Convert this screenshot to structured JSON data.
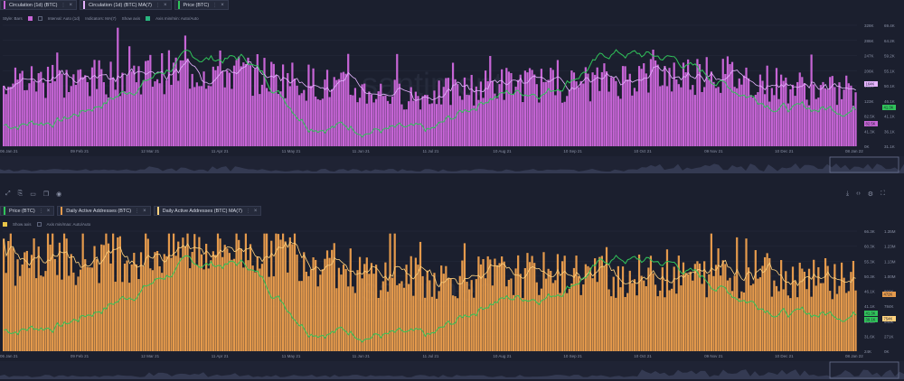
{
  "top": {
    "tabs": [
      {
        "label": "Circulation (1d) (BTC)",
        "color": "#c765d6"
      },
      {
        "label": "Circulation (1d) (BTC) MA(7)",
        "color": "#e6b4ff"
      },
      {
        "label": "Price (BTC)",
        "color": "#30c45a"
      }
    ],
    "toolbar": {
      "style": "Style: Bars",
      "interval": "Interval: Auto (1d)",
      "indicators": "Indicators: MA(7)",
      "show_axis": "Show axis",
      "axis_mode": "Axis min/min: Auto/Auto"
    }
  },
  "bottom": {
    "tabs": [
      {
        "label": "Price (BTC)",
        "color": "#30c45a"
      },
      {
        "label": "Daily Active Addresses (BTC)",
        "color": "#e59a4c"
      },
      {
        "label": "Daily Active Addresses (BTC) MA(7)",
        "color": "#ffd27f"
      }
    ],
    "toolbar": {
      "show_axis": "Show axis",
      "axis_mode": "Axis min/max: Auto/Auto"
    }
  },
  "watermark": "santiment",
  "icons": [
    "expand-icon",
    "link-icon",
    "comment-icon",
    "copy-icon",
    "eye-icon",
    "download-icon",
    "embed-icon",
    "settings-icon",
    "fullscreen-icon"
  ],
  "chart_data": [
    {
      "type": "bar",
      "title": "",
      "x_ticks": [
        "06 Jan 21",
        "09 Feb 21",
        "12 Mar 21",
        "11 Apr 21",
        "11 May 21",
        "11 Jun 21",
        "11 Jul 21",
        "10 Aug 21",
        "10 Sep 21",
        "10 Oct 21",
        "09 Nov 21",
        "10 Dec 21",
        "08 Jan 22"
      ],
      "x_range": [
        "2021-01-06",
        "2022-01-08"
      ],
      "series": [
        {
          "name": "Circulation (1d) (BTC)",
          "kind": "bar",
          "color": "#c765d6",
          "axis": "left",
          "values_monthly_avg": [
            180000,
            175000,
            200000,
            205000,
            185000,
            150000,
            135000,
            170000,
            165000,
            190000,
            200000,
            165000,
            140000
          ],
          "range": [
            0,
            328000
          ]
        },
        {
          "name": "Circulation (1d) (BTC) MA(7)",
          "kind": "line",
          "color": "#e6b4ff",
          "axis": "left"
        },
        {
          "name": "Price (BTC)",
          "kind": "line",
          "color": "#30c45a",
          "axis": "right",
          "monthly_close": [
            36000,
            38000,
            47000,
            58000,
            58000,
            37000,
            35000,
            33000,
            46000,
            48000,
            60000,
            58000,
            48000,
            41000,
            42000
          ],
          "range": [
            29000,
            69000
          ]
        }
      ],
      "left_ticks": [
        "328K",
        "286K",
        "247K",
        "206K",
        "164K",
        "123K",
        "82.5K",
        "41.3K",
        "0K"
      ],
      "right_ticks": [
        "69.4K",
        "64.2K",
        "59.2K",
        "55.1K",
        "50.1K",
        "46.1K",
        "41.1K",
        "36.1K",
        "31.1K"
      ],
      "last_value_labels": [
        "164K",
        "41.3K",
        "82.5K"
      ],
      "grid": true
    },
    {
      "type": "bar",
      "title": "",
      "x_ticks": [
        "06 Jan 21",
        "09 Feb 21",
        "12 Mar 21",
        "11 Apr 21",
        "11 May 21",
        "11 Jun 21",
        "11 Jul 21",
        "10 Aug 21",
        "10 Sep 21",
        "10 Oct 21",
        "09 Nov 21",
        "10 Dec 21",
        "08 Jan 22"
      ],
      "x_range": [
        "2021-01-06",
        "2022-01-08"
      ],
      "series": [
        {
          "name": "Daily Active Addresses (BTC)",
          "kind": "bar",
          "color": "#e59a4c",
          "axis": "right",
          "values_monthly_avg": [
            1050000,
            1100000,
            1150000,
            1250000,
            1200000,
            900000,
            850000,
            880000,
            900000,
            870000,
            880000,
            880000,
            860000
          ],
          "range": [
            0,
            1400000
          ]
        },
        {
          "name": "Daily Active Addresses (BTC) MA(7)",
          "kind": "line",
          "color": "#ffd27f",
          "axis": "right"
        },
        {
          "name": "Price (BTC)",
          "kind": "line",
          "color": "#30c45a",
          "axis": "left",
          "range": [
            29000,
            69000
          ]
        }
      ],
      "left_ticks": [
        "66.3K",
        "60.3K",
        "55.3K",
        "50.3K",
        "46.1K",
        "41.1K",
        "36.1K",
        "31.6K",
        "24K"
      ],
      "right_ticks": [
        "1.35M",
        "1.23M",
        "1.13M",
        "1.00M",
        "890K",
        "784K",
        "540K",
        "271K",
        "0K"
      ],
      "last_value_labels": [
        "472K",
        "41.3K",
        "39.1K",
        "754K"
      ],
      "grid": true
    }
  ]
}
